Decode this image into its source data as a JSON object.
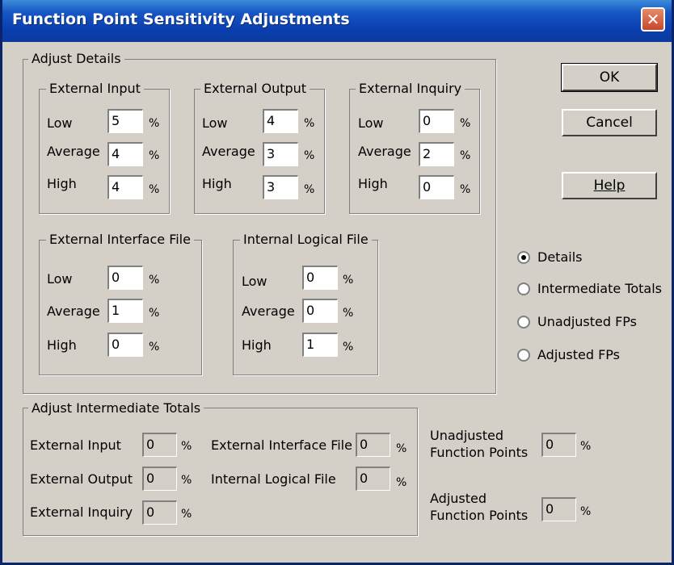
{
  "window": {
    "title": "Function Point Sensitivity Adjustments",
    "close_glyph": "✕"
  },
  "adjust_details": {
    "label": "Adjust Details",
    "row_labels": {
      "low": "Low",
      "average": "Average",
      "high": "High"
    },
    "percent": "%",
    "external_input": {
      "label": "External Input",
      "low": "5",
      "average": "4",
      "high": "4"
    },
    "external_output": {
      "label": "External Output",
      "low": "4",
      "average": "3",
      "high": "3"
    },
    "external_inquiry": {
      "label": "External Inquiry",
      "low": "0",
      "average": "2",
      "high": "0"
    },
    "external_interface_file": {
      "label": "External Interface File",
      "low": "0",
      "average": "1",
      "high": "0"
    },
    "internal_logical_file": {
      "label": "Internal Logical File",
      "low": "0",
      "average": "0",
      "high": "1"
    }
  },
  "buttons": {
    "ok": "OK",
    "cancel": "Cancel",
    "help": "Help"
  },
  "view_options": {
    "selected": "Details",
    "items": [
      "Details",
      "Intermediate Totals",
      "Unadjusted FPs",
      "Adjusted FPs"
    ]
  },
  "adjust_intermediate": {
    "label": "Adjust Intermediate Totals",
    "external_input": {
      "label": "External Input",
      "value": "0"
    },
    "external_output": {
      "label": "External Output",
      "value": "0"
    },
    "external_inquiry": {
      "label": "External Inquiry",
      "value": "0"
    },
    "external_interface_file": {
      "label": "External Interface File",
      "value": "0"
    },
    "internal_logical_file": {
      "label": "Internal Logical File",
      "value": "0"
    }
  },
  "unadjusted_fp": {
    "label_line1": "Unadjusted",
    "label_line2": "Function Points",
    "value": "0"
  },
  "adjusted_fp": {
    "label_line1": "Adjusted",
    "label_line2": "Function Points",
    "value": "0"
  },
  "colors": {
    "title_bar": "#0a3fb0",
    "dialog_bg": "#d4d0c8",
    "close_button": "#c8472a"
  }
}
